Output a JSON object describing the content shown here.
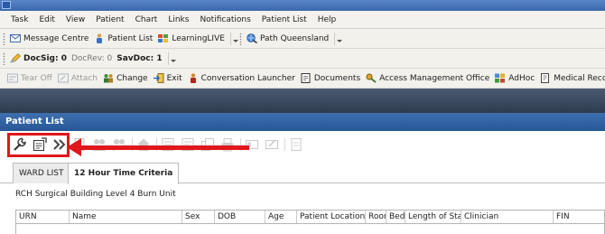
{
  "menubar": {
    "items": [
      "Task",
      "Edit",
      "View",
      "Patient",
      "Chart",
      "Links",
      "Notifications",
      "Patient List",
      "Help"
    ]
  },
  "toolbar1": {
    "message_centre": "Message Centre",
    "patient_list": "Patient List",
    "learninglive": "LearningLIVE",
    "path_queensland": "Path Queensland"
  },
  "toolbar2": {
    "docsig_label": "DocSig: 0",
    "docrev_label": "DocRev: 0",
    "savdoc_label": "SavDoc: 1"
  },
  "toolbar3": {
    "tear_off": "Tear Off",
    "attach": "Attach",
    "change": "Change",
    "exit": "Exit",
    "conversation_launcher": "Conversation Launcher",
    "documents": "Documents",
    "access_management_office": "Access Management Office",
    "adhoc": "AdHoc",
    "medical_record_request": "Medical Record Reque"
  },
  "panel": {
    "title": "Patient List",
    "tabs": [
      "WARD LIST",
      "12 Hour Time Criteria"
    ],
    "location": "RCH Surgical Building Level 4 Burn Unit",
    "columns": [
      "URN",
      "Name",
      "Sex",
      "DOB",
      "Age",
      "Patient Location",
      "Room",
      "Bed",
      "Length of Stay",
      "Clinician",
      "FIN"
    ]
  },
  "colors": {
    "annotation_red": "#e0171b",
    "panel_header_blue": "#285797"
  }
}
